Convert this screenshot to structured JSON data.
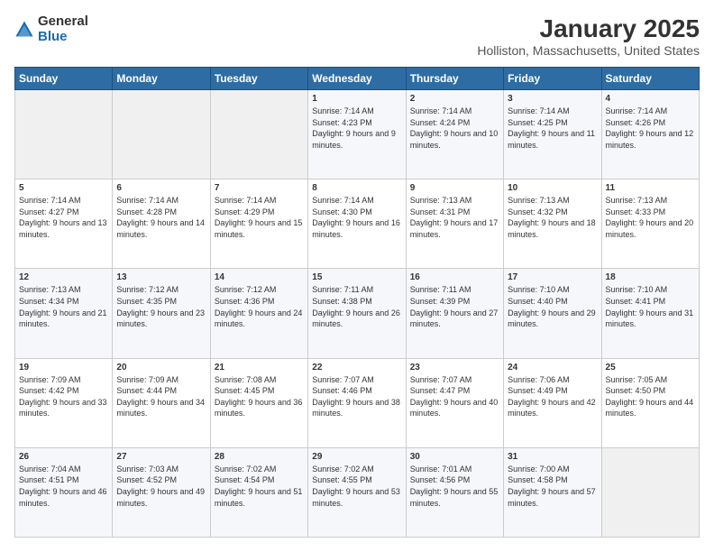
{
  "logo": {
    "general": "General",
    "blue": "Blue"
  },
  "header": {
    "month": "January 2025",
    "location": "Holliston, Massachusetts, United States"
  },
  "weekdays": [
    "Sunday",
    "Monday",
    "Tuesday",
    "Wednesday",
    "Thursday",
    "Friday",
    "Saturday"
  ],
  "weeks": [
    [
      {
        "day": "",
        "empty": true
      },
      {
        "day": "",
        "empty": true
      },
      {
        "day": "",
        "empty": true
      },
      {
        "day": "1",
        "sunrise": "7:14 AM",
        "sunset": "4:23 PM",
        "daylight": "9 hours and 9 minutes."
      },
      {
        "day": "2",
        "sunrise": "7:14 AM",
        "sunset": "4:24 PM",
        "daylight": "9 hours and 10 minutes."
      },
      {
        "day": "3",
        "sunrise": "7:14 AM",
        "sunset": "4:25 PM",
        "daylight": "9 hours and 11 minutes."
      },
      {
        "day": "4",
        "sunrise": "7:14 AM",
        "sunset": "4:26 PM",
        "daylight": "9 hours and 12 minutes."
      }
    ],
    [
      {
        "day": "5",
        "sunrise": "7:14 AM",
        "sunset": "4:27 PM",
        "daylight": "9 hours and 13 minutes."
      },
      {
        "day": "6",
        "sunrise": "7:14 AM",
        "sunset": "4:28 PM",
        "daylight": "9 hours and 14 minutes."
      },
      {
        "day": "7",
        "sunrise": "7:14 AM",
        "sunset": "4:29 PM",
        "daylight": "9 hours and 15 minutes."
      },
      {
        "day": "8",
        "sunrise": "7:14 AM",
        "sunset": "4:30 PM",
        "daylight": "9 hours and 16 minutes."
      },
      {
        "day": "9",
        "sunrise": "7:13 AM",
        "sunset": "4:31 PM",
        "daylight": "9 hours and 17 minutes."
      },
      {
        "day": "10",
        "sunrise": "7:13 AM",
        "sunset": "4:32 PM",
        "daylight": "9 hours and 18 minutes."
      },
      {
        "day": "11",
        "sunrise": "7:13 AM",
        "sunset": "4:33 PM",
        "daylight": "9 hours and 20 minutes."
      }
    ],
    [
      {
        "day": "12",
        "sunrise": "7:13 AM",
        "sunset": "4:34 PM",
        "daylight": "9 hours and 21 minutes."
      },
      {
        "day": "13",
        "sunrise": "7:12 AM",
        "sunset": "4:35 PM",
        "daylight": "9 hours and 23 minutes."
      },
      {
        "day": "14",
        "sunrise": "7:12 AM",
        "sunset": "4:36 PM",
        "daylight": "9 hours and 24 minutes."
      },
      {
        "day": "15",
        "sunrise": "7:11 AM",
        "sunset": "4:38 PM",
        "daylight": "9 hours and 26 minutes."
      },
      {
        "day": "16",
        "sunrise": "7:11 AM",
        "sunset": "4:39 PM",
        "daylight": "9 hours and 27 minutes."
      },
      {
        "day": "17",
        "sunrise": "7:10 AM",
        "sunset": "4:40 PM",
        "daylight": "9 hours and 29 minutes."
      },
      {
        "day": "18",
        "sunrise": "7:10 AM",
        "sunset": "4:41 PM",
        "daylight": "9 hours and 31 minutes."
      }
    ],
    [
      {
        "day": "19",
        "sunrise": "7:09 AM",
        "sunset": "4:42 PM",
        "daylight": "9 hours and 33 minutes."
      },
      {
        "day": "20",
        "sunrise": "7:09 AM",
        "sunset": "4:44 PM",
        "daylight": "9 hours and 34 minutes."
      },
      {
        "day": "21",
        "sunrise": "7:08 AM",
        "sunset": "4:45 PM",
        "daylight": "9 hours and 36 minutes."
      },
      {
        "day": "22",
        "sunrise": "7:07 AM",
        "sunset": "4:46 PM",
        "daylight": "9 hours and 38 minutes."
      },
      {
        "day": "23",
        "sunrise": "7:07 AM",
        "sunset": "4:47 PM",
        "daylight": "9 hours and 40 minutes."
      },
      {
        "day": "24",
        "sunrise": "7:06 AM",
        "sunset": "4:49 PM",
        "daylight": "9 hours and 42 minutes."
      },
      {
        "day": "25",
        "sunrise": "7:05 AM",
        "sunset": "4:50 PM",
        "daylight": "9 hours and 44 minutes."
      }
    ],
    [
      {
        "day": "26",
        "sunrise": "7:04 AM",
        "sunset": "4:51 PM",
        "daylight": "9 hours and 46 minutes."
      },
      {
        "day": "27",
        "sunrise": "7:03 AM",
        "sunset": "4:52 PM",
        "daylight": "9 hours and 49 minutes."
      },
      {
        "day": "28",
        "sunrise": "7:02 AM",
        "sunset": "4:54 PM",
        "daylight": "9 hours and 51 minutes."
      },
      {
        "day": "29",
        "sunrise": "7:02 AM",
        "sunset": "4:55 PM",
        "daylight": "9 hours and 53 minutes."
      },
      {
        "day": "30",
        "sunrise": "7:01 AM",
        "sunset": "4:56 PM",
        "daylight": "9 hours and 55 minutes."
      },
      {
        "day": "31",
        "sunrise": "7:00 AM",
        "sunset": "4:58 PM",
        "daylight": "9 hours and 57 minutes."
      },
      {
        "day": "",
        "empty": true
      }
    ]
  ],
  "labels": {
    "sunrise": "Sunrise:",
    "sunset": "Sunset:",
    "daylight": "Daylight:"
  }
}
